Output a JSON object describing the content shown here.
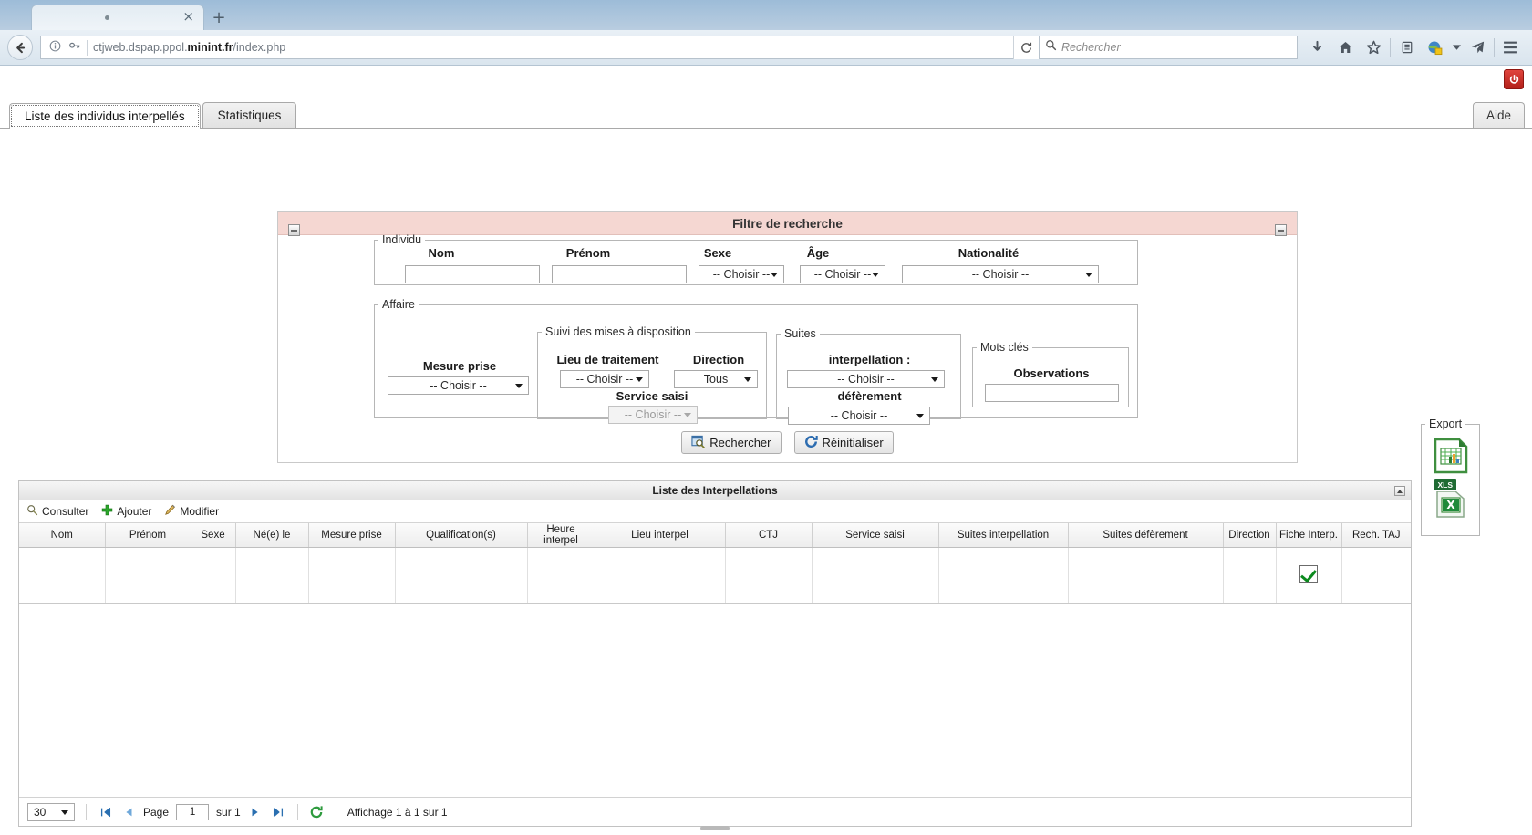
{
  "browser": {
    "tab_title": "",
    "new_tab_label": "+",
    "close_label": "×",
    "url_prefix": "ctjweb.dspap.ppol.",
    "url_bold": "minint.fr",
    "url_suffix": "/index.php",
    "search_placeholder": "Rechercher",
    "icons": {
      "back": "back-arrow-icon",
      "info": "page-info-icon",
      "key": "key-icon",
      "reload": "reload-icon",
      "search": "search-icon",
      "download": "download-icon",
      "home": "home-icon",
      "bookmark": "star-icon",
      "reader": "reader-list-icon",
      "globe": "globe-icon",
      "dropdown": "chevron-down-icon",
      "send": "send-icon",
      "menu": "hamburger-menu-icon"
    }
  },
  "app": {
    "power_label": "⏻",
    "tabs": [
      {
        "label": "Liste des individus interpellés",
        "active": true
      },
      {
        "label": "Statistiques",
        "active": false
      }
    ],
    "help_label": "Aide"
  },
  "filter": {
    "title": "Filtre de recherche",
    "individu": {
      "legend": "Individu",
      "fields": [
        {
          "label": "Nom",
          "type": "text",
          "value": ""
        },
        {
          "label": "Prénom",
          "type": "text",
          "value": ""
        },
        {
          "label": "Sexe",
          "type": "select",
          "value": "-- Choisir --"
        },
        {
          "label": "Âge",
          "type": "select",
          "value": "-- Choisir --"
        },
        {
          "label": "Nationalité",
          "type": "select",
          "value": "-- Choisir --"
        }
      ]
    },
    "affaire": {
      "legend": "Affaire",
      "mesure_prise": {
        "label": "Mesure prise",
        "value": "-- Choisir --"
      },
      "suivi": {
        "legend": "Suivi des mises à disposition",
        "lieu_traitement": {
          "label": "Lieu de traitement",
          "value": "-- Choisir --"
        },
        "direction": {
          "label": "Direction",
          "value": "Tous"
        },
        "service_saisi": {
          "label": "Service saisi",
          "value": "-- Choisir --",
          "disabled": true
        }
      },
      "suites": {
        "legend": "Suites",
        "interpellation": {
          "label": "interpellation :",
          "value": "-- Choisir --"
        },
        "deferement": {
          "label": "défèrement",
          "value": "-- Choisir --"
        }
      },
      "mots_cles": {
        "legend": "Mots clés",
        "observations": {
          "label": "Observations",
          "value": ""
        }
      }
    },
    "export": {
      "legend": "Export",
      "ods_icon": "spreadsheet-export-icon",
      "xls_icon": "xls-export-icon",
      "xls_badge": "XLS"
    },
    "buttons": {
      "search": {
        "label": "Rechercher",
        "icon": "search-window-icon"
      },
      "reset": {
        "label": "Réinitialiser",
        "icon": "refresh-circle-icon"
      }
    }
  },
  "list": {
    "title": "Liste des Interpellations",
    "collapse_icon": "collapse-up-icon",
    "toolbar": [
      {
        "label": "Consulter",
        "icon": "magnifier-icon"
      },
      {
        "label": "Ajouter",
        "icon": "plus-icon"
      },
      {
        "label": "Modifier",
        "icon": "pencil-icon"
      }
    ],
    "columns": [
      "Nom",
      "Prénom",
      "Sexe",
      "Né(e) le",
      "Mesure prise",
      "Qualification(s)",
      "Heure interpel",
      "Lieu interpel",
      "CTJ",
      "Service saisi",
      "Suites interpellation",
      "Suites défèrement",
      "Direction",
      "Fiche Interp.",
      "Rech. TAJ"
    ],
    "rows": [
      {
        "Nom": "",
        "Prénom": "",
        "Sexe": "",
        "Né(e) le": "",
        "Mesure prise": "",
        "Qualification(s)": "",
        "Heure interpel": "",
        "Lieu interpel": "",
        "CTJ": "",
        "Service saisi": "",
        "Suites interpellation": "",
        "Suites défèrement": "",
        "Direction": "",
        "Fiche Interp.": "check",
        "Rech. TAJ": ""
      }
    ],
    "pager": {
      "page_size": "30",
      "first_icon": "first-page-icon",
      "prev_icon": "prev-page-icon",
      "page_label": "Page",
      "page_value": "1",
      "of_label": "sur 1",
      "next_icon": "next-page-icon",
      "last_icon": "last-page-icon",
      "refresh_icon": "refresh-icon",
      "status": "Affichage 1 à 1 sur 1"
    }
  }
}
